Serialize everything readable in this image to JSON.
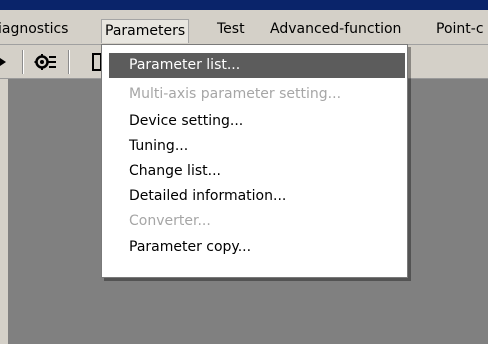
{
  "menubar": {
    "items": [
      {
        "label": "iagnostics",
        "active": false
      },
      {
        "label": "Parameters",
        "active": true
      },
      {
        "label": "Test",
        "active": false
      },
      {
        "label": "Advanced-function",
        "active": false
      },
      {
        "label": "Point-c",
        "active": false
      }
    ]
  },
  "toolbar": {
    "icons": [
      "arrow-icon",
      "gear-settings-icon",
      "page-icon"
    ]
  },
  "parameters_menu": {
    "items": [
      {
        "label": "Parameter list...",
        "state": "highlighted"
      },
      {
        "label": "Multi-axis parameter setting...",
        "state": "disabled"
      },
      {
        "label": "Device setting...",
        "state": "enabled"
      },
      {
        "label": "Tuning...",
        "state": "enabled"
      },
      {
        "label": "Change list...",
        "state": "enabled"
      },
      {
        "label": "Detailed information...",
        "state": "enabled"
      },
      {
        "label": "Converter...",
        "state": "disabled"
      },
      {
        "label": "Parameter copy...",
        "state": "enabled"
      }
    ]
  },
  "colors": {
    "menubar_bg": "#d4d0c8",
    "workspace_bg": "#808080",
    "highlight_bg": "#5c5c5c",
    "disabled_text": "#a6a6a6"
  }
}
